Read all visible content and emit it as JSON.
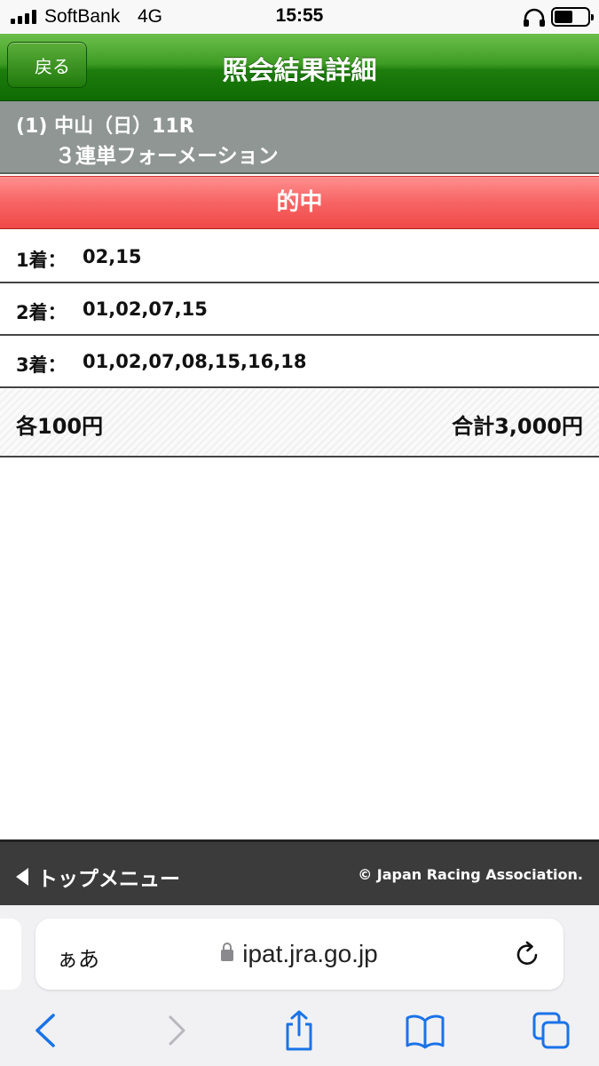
{
  "status_bar": {
    "carrier": "SoftBank",
    "network": "4G",
    "time": "15:55",
    "icons": [
      "signal-bars-icon",
      "headphone-icon",
      "battery-icon"
    ]
  },
  "header": {
    "back_label": "戻る",
    "title": "照会結果詳細",
    "accent_color": "#1d7d0c"
  },
  "race": {
    "line": "(1) 中山（日）11R",
    "bet_type": "３連単フォーメーション"
  },
  "result_banner": {
    "label": "的中",
    "color": "#f76464"
  },
  "selections": [
    {
      "place": "1着：",
      "numbers": "02,15"
    },
    {
      "place": "2着：",
      "numbers": "01,02,07,15"
    },
    {
      "place": "3着：",
      "numbers": "01,02,07,08,15,16,18"
    }
  ],
  "summary": {
    "each": "各100円",
    "total": "合計3,000円"
  },
  "footer": {
    "top_menu_label": "トップメニュー",
    "copyright": "© Japan Racing Association."
  },
  "browser": {
    "aa_label": "ぁあ",
    "url": "ipat.jra.go.jp",
    "toolbar_icons": [
      "back-icon",
      "forward-icon",
      "share-icon",
      "bookmarks-icon",
      "tabs-icon"
    ]
  }
}
